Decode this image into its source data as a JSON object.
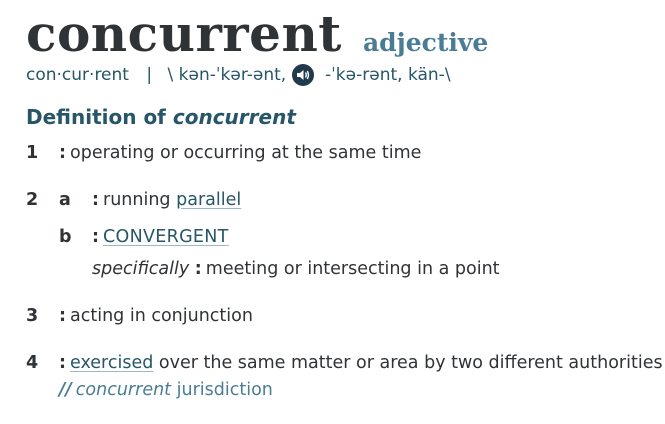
{
  "entry": {
    "headword": "concurrent",
    "part_of_speech": "adjective"
  },
  "pronunciation": {
    "syllables": "con·cur·rent",
    "separator": "|",
    "primary": "\\ kən-ˈkər-ənt,",
    "alternate": "-ˈkə-rənt, kän-\\",
    "audio_icon": "speaker-icon"
  },
  "definition_heading": {
    "prefix": "Definition of",
    "word": "concurrent"
  },
  "senses": {
    "s1": {
      "num": "1",
      "colon": ":",
      "text": "operating or occurring at the same time"
    },
    "s2a": {
      "num": "2",
      "letter": "a",
      "colon": ":",
      "text": "running",
      "link": "parallel"
    },
    "s2b": {
      "letter": "b",
      "colon": ":",
      "link": "CONVERGENT"
    },
    "s2b_spec": {
      "label": "specifically",
      "colon": ":",
      "text": "meeting or intersecting in a point"
    },
    "s3": {
      "num": "3",
      "colon": ":",
      "text": "acting in conjunction"
    },
    "s4": {
      "num": "4",
      "colon": ":",
      "link": "exercised",
      "text": "over the same matter or area by two different authorities"
    },
    "s4_example": {
      "mark": "//",
      "word": "concurrent",
      "text": "jurisdiction"
    }
  },
  "colors": {
    "headword": "#303336",
    "part_of_speech": "#4a7d95",
    "heading": "#265667",
    "link": "#265667",
    "example": "#4a7d95"
  }
}
